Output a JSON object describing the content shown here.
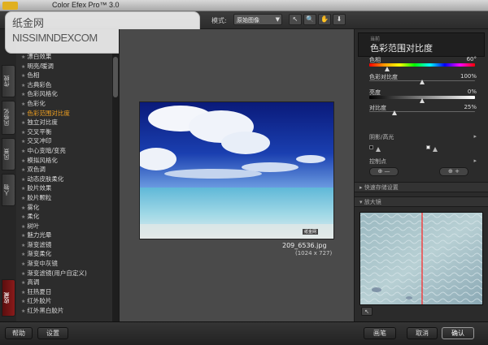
{
  "app": {
    "title": "Color Efex Pro™ 3.0"
  },
  "watermark": {
    "line1": "纸金网",
    "line2": "NISSIMNDEXCOM"
  },
  "toolbar": {
    "mode_label": "模式:",
    "mode_value": "原始图像",
    "tools": [
      "↖",
      "🔍",
      "✋",
      "⬇"
    ]
  },
  "side_tabs": [
    "传统",
    "风格化",
    "风景",
    "人物",
    "收藏"
  ],
  "filters": [
    "漂白效果",
    "明亮/暖调",
    "色相",
    "古典彩色",
    "色彩风格化",
    "色彩化",
    "色彩范围对比度",
    "独立对比度",
    "交叉平衡",
    "交叉冲印",
    "中心变暗/变亮",
    "模拟风格化",
    "双色调",
    "动态皮肤柔化",
    "胶片效果",
    "胶片颗粒",
    "雾化",
    "柔化",
    "树叶",
    "魅力光晕",
    "渐变滤镜",
    "渐变柔化",
    "渐变中灰镜",
    "渐变滤镜(用户自定义)",
    "高调",
    "狂热夏日",
    "红外胶片",
    "红外黑白胶片"
  ],
  "active_filter_index": 6,
  "image": {
    "filename": "209_6536.jpg",
    "dimensions": "(1024 x 727)",
    "overlay_text": "纸金网"
  },
  "right_panel": {
    "filter_subtitle": "当前",
    "filter_title": "色彩范围对比度",
    "params": [
      {
        "label": "色相",
        "value": "60°",
        "position": 0.17
      },
      {
        "label": "色彩对比度",
        "value": "100%",
        "position": 0.5
      },
      {
        "label": "亮度",
        "value": "0%",
        "position": 0.5
      },
      {
        "label": "对比度",
        "value": "25%",
        "position": 0.25
      }
    ],
    "shadows_highlights_label": "阴影/高光",
    "control_points_label": "控制点",
    "control_point_buttons": [
      "⊕ —",
      "⊕ +"
    ],
    "section_quick_save": "快速存储设置",
    "section_loupe": "放大镜",
    "loupe_tool": "↖"
  },
  "bottom": {
    "help": "帮助",
    "settings": "设置",
    "brush": "画笔",
    "cancel": "取消",
    "ok": "确认"
  },
  "colors": {
    "accent_orange": "#f0a020",
    "favorites_tab": "#8a1a1a",
    "loupe_line": "#ff2020"
  }
}
